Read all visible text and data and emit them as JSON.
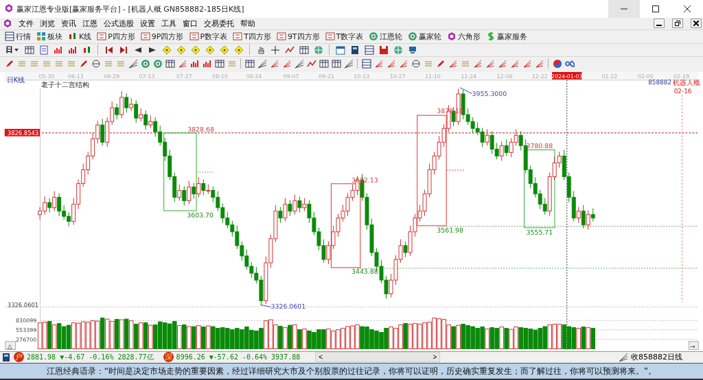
{
  "window": {
    "title": "赢家江恩专业版[赢家服务平台] - [机器人概  GN858882-185日K线]"
  },
  "menu": [
    "文件",
    "浏览",
    "资讯",
    "江恩",
    "公式选股",
    "设置",
    "工具",
    "窗口",
    "交易委托",
    "帮助"
  ],
  "toolbar": [
    "行情",
    "板块",
    "K线",
    "P四方形",
    "9P四方形",
    "P数字表",
    "T四方形",
    "9T四方形",
    "T数字表",
    "江恩轮",
    "赢家轮",
    "六角形",
    "赢家服务"
  ],
  "period_selector": {
    "label": "日"
  },
  "chart": {
    "period_label": "日K线",
    "title": "老子十二宫结构",
    "dates": [
      {
        "label": "05-30",
        "selected": false
      },
      {
        "label": "06-13",
        "selected": false
      },
      {
        "label": "06-29",
        "selected": false
      },
      {
        "label": "07-13",
        "selected": false
      },
      {
        "label": "07-27",
        "selected": false
      },
      {
        "label": "08-10",
        "selected": false
      },
      {
        "label": "08-24",
        "selected": false
      },
      {
        "label": "09-07",
        "selected": false
      },
      {
        "label": "09-21",
        "selected": false
      },
      {
        "label": "10-13",
        "selected": false
      },
      {
        "label": "10-27",
        "selected": false
      },
      {
        "label": "11-10",
        "selected": false
      },
      {
        "label": "11-24",
        "selected": false
      },
      {
        "label": "12-08",
        "selected": false
      },
      {
        "label": "12-22",
        "selected": false
      },
      {
        "label": "2024-01-03",
        "selected": true
      },
      {
        "label": "01-22",
        "selected": false
      },
      {
        "label": "02-05",
        "selected": false
      },
      {
        "label": "02-19",
        "selected": false
      }
    ],
    "annotations": [
      "3955.3000",
      "3878.18",
      "3828.68",
      "3780.88",
      "3682.13",
      "3603.70",
      "3561.98",
      "3555.71",
      "3443.88",
      "3326.0601"
    ],
    "code": "858882",
    "name": "机器人概",
    "marker_date": "02-16",
    "collapse_button": "△",
    "scroll_button": "→",
    "chart_data": {
      "type": "candlestick",
      "ylim": [
        3326.0601,
        3955.3
      ],
      "yticks": [
        {
          "value": 3826.8543,
          "label": "3826.8543"
        },
        {
          "value": 3326.0601,
          "label": "3326.0601"
        }
      ],
      "categories": [
        null,
        null,
        null,
        null,
        null,
        null,
        null,
        null,
        null,
        null,
        null,
        null,
        null,
        null,
        null,
        null,
        null,
        null,
        null,
        null,
        null,
        null,
        null,
        null,
        null,
        null,
        null,
        null,
        null,
        null,
        null,
        null,
        null,
        null,
        null,
        null,
        null,
        null,
        null,
        null,
        null,
        null,
        null,
        null,
        null,
        null,
        null,
        null,
        null,
        null,
        null,
        null,
        null,
        null,
        null,
        null,
        null,
        null,
        null,
        null,
        null,
        null,
        null,
        null,
        null,
        null,
        null,
        null,
        null,
        null,
        null,
        null,
        null,
        null,
        null,
        null,
        null,
        null,
        null,
        null,
        null,
        null,
        null,
        null,
        null,
        null,
        null,
        null,
        null,
        null,
        null,
        null,
        null,
        null,
        null,
        null,
        null,
        null,
        null,
        null,
        null,
        null,
        null,
        null,
        null,
        null,
        null,
        null,
        null,
        null,
        null,
        null,
        null,
        null,
        null,
        null
      ],
      "ohlc": [
        [
          3590,
          3612,
          3576,
          3600
        ],
        [
          3600,
          3643,
          3590,
          3625
        ],
        [
          3625,
          3637,
          3596,
          3610
        ],
        [
          3610,
          3658,
          3600,
          3640
        ],
        [
          3640,
          3652,
          3586,
          3600
        ],
        [
          3600,
          3618,
          3575,
          3585
        ],
        [
          3585,
          3597,
          3556,
          3570
        ],
        [
          3570,
          3638,
          3560,
          3620
        ],
        [
          3620,
          3692,
          3606,
          3680
        ],
        [
          3680,
          3738,
          3670,
          3720
        ],
        [
          3720,
          3772,
          3706,
          3760
        ],
        [
          3760,
          3828,
          3750,
          3810
        ],
        [
          3810,
          3862,
          3796,
          3850
        ],
        [
          3850,
          3868,
          3790,
          3800
        ],
        [
          3800,
          3872,
          3786,
          3860
        ],
        [
          3860,
          3918,
          3850,
          3900
        ],
        [
          3900,
          3912,
          3866,
          3880
        ],
        [
          3880,
          3948,
          3870,
          3930
        ],
        [
          3930,
          3942,
          3886,
          3900
        ],
        [
          3900,
          3928,
          3890,
          3910
        ],
        [
          3910,
          3922,
          3856,
          3870
        ],
        [
          3870,
          3898,
          3860,
          3880
        ],
        [
          3880,
          3892,
          3836,
          3850
        ],
        [
          3850,
          3878,
          3840,
          3860
        ],
        [
          3860,
          3872,
          3816,
          3830
        ],
        [
          3830,
          3848,
          3790,
          3800
        ],
        [
          3800,
          3812,
          3746,
          3760
        ],
        [
          3760,
          3778,
          3690,
          3700
        ],
        [
          3700,
          3712,
          3626,
          3640
        ],
        [
          3640,
          3678,
          3630,
          3660
        ],
        [
          3660,
          3672,
          3616,
          3630
        ],
        [
          3630,
          3688,
          3620,
          3670
        ],
        [
          3670,
          3682,
          3636,
          3650
        ],
        [
          3650,
          3698,
          3640,
          3680
        ],
        [
          3680,
          3692,
          3646,
          3660
        ],
        [
          3660,
          3678,
          3650,
          3660
        ],
        [
          3660,
          3672,
          3626,
          3640
        ],
        [
          3640,
          3658,
          3600,
          3610
        ],
        [
          3610,
          3622,
          3566,
          3580
        ],
        [
          3580,
          3598,
          3550,
          3560
        ],
        [
          3560,
          3572,
          3526,
          3540
        ],
        [
          3540,
          3558,
          3490,
          3500
        ],
        [
          3500,
          3512,
          3456,
          3470
        ],
        [
          3470,
          3488,
          3430,
          3440
        ],
        [
          3440,
          3452,
          3406,
          3420
        ],
        [
          3420,
          3438,
          3390,
          3400
        ],
        [
          3400,
          3412,
          3326,
          3340
        ],
        [
          3340,
          3468,
          3330,
          3450
        ],
        [
          3450,
          3532,
          3436,
          3520
        ],
        [
          3520,
          3618,
          3510,
          3600
        ],
        [
          3600,
          3612,
          3566,
          3580
        ],
        [
          3580,
          3638,
          3570,
          3620
        ],
        [
          3620,
          3632,
          3586,
          3600
        ],
        [
          3600,
          3648,
          3590,
          3630
        ],
        [
          3630,
          3642,
          3596,
          3610
        ],
        [
          3610,
          3638,
          3600,
          3620
        ],
        [
          3620,
          3632,
          3566,
          3580
        ],
        [
          3580,
          3598,
          3530,
          3540
        ],
        [
          3540,
          3552,
          3486,
          3500
        ],
        [
          3500,
          3518,
          3450,
          3460
        ],
        [
          3460,
          3512,
          3446,
          3500
        ],
        [
          3500,
          3558,
          3490,
          3540
        ],
        [
          3540,
          3592,
          3526,
          3580
        ],
        [
          3580,
          3618,
          3570,
          3600
        ],
        [
          3600,
          3652,
          3586,
          3640
        ],
        [
          3640,
          3678,
          3630,
          3660
        ],
        [
          3660,
          3702,
          3646,
          3690
        ],
        [
          3690,
          3708,
          3630,
          3640
        ],
        [
          3640,
          3652,
          3546,
          3560
        ],
        [
          3560,
          3578,
          3470,
          3480
        ],
        [
          3480,
          3492,
          3426,
          3440
        ],
        [
          3440,
          3458,
          3390,
          3400
        ],
        [
          3400,
          3412,
          3346,
          3360
        ],
        [
          3360,
          3418,
          3350,
          3400
        ],
        [
          3400,
          3472,
          3386,
          3460
        ],
        [
          3460,
          3518,
          3450,
          3500
        ],
        [
          3500,
          3512,
          3466,
          3480
        ],
        [
          3480,
          3558,
          3470,
          3540
        ],
        [
          3540,
          3592,
          3526,
          3580
        ],
        [
          3580,
          3618,
          3570,
          3600
        ],
        [
          3600,
          3662,
          3586,
          3650
        ],
        [
          3650,
          3738,
          3640,
          3720
        ],
        [
          3720,
          3772,
          3706,
          3760
        ],
        [
          3760,
          3818,
          3750,
          3800
        ],
        [
          3800,
          3852,
          3786,
          3840
        ],
        [
          3840,
          3908,
          3830,
          3890
        ],
        [
          3890,
          3902,
          3846,
          3860
        ],
        [
          3860,
          3955,
          3850,
          3940
        ],
        [
          3940,
          3952,
          3866,
          3880
        ],
        [
          3880,
          3898,
          3850,
          3860
        ],
        [
          3860,
          3872,
          3826,
          3840
        ],
        [
          3840,
          3858,
          3820,
          3830
        ],
        [
          3830,
          3842,
          3786,
          3800
        ],
        [
          3800,
          3838,
          3790,
          3820
        ],
        [
          3820,
          3832,
          3766,
          3780
        ],
        [
          3780,
          3798,
          3750,
          3760
        ],
        [
          3760,
          3802,
          3746,
          3790
        ],
        [
          3790,
          3808,
          3760,
          3770
        ],
        [
          3770,
          3812,
          3756,
          3800
        ],
        [
          3800,
          3838,
          3790,
          3820
        ],
        [
          3820,
          3832,
          3776,
          3790
        ],
        [
          3790,
          3808,
          3710,
          3720
        ],
        [
          3720,
          3732,
          3666,
          3680
        ],
        [
          3680,
          3698,
          3640,
          3650
        ],
        [
          3650,
          3662,
          3606,
          3620
        ],
        [
          3620,
          3638,
          3590,
          3600
        ],
        [
          3600,
          3712,
          3586,
          3700
        ],
        [
          3700,
          3758,
          3690,
          3740
        ],
        [
          3740,
          3772,
          3726,
          3760
        ],
        [
          3760,
          3778,
          3690,
          3700
        ],
        [
          3700,
          3712,
          3626,
          3640
        ],
        [
          3640,
          3658,
          3570,
          3580
        ],
        [
          3580,
          3612,
          3566,
          3600
        ],
        [
          3600,
          3618,
          3550,
          3560
        ],
        [
          3560,
          3602,
          3546,
          3590
        ],
        [
          3590,
          3608,
          3570,
          3580
        ]
      ]
    },
    "volume": {
      "chart_data": {
        "type": "bar",
        "ylim": [
          0,
          1225400
        ],
        "yticks": [
          {
            "value": 276700,
            "label": "276700"
          },
          {
            "value": 553399,
            "label": "553399"
          },
          {
            "value": 830099,
            "label": "830099"
          }
        ],
        "categories": [
          null,
          null,
          null,
          null,
          null,
          null,
          null,
          null,
          null,
          null,
          null,
          null,
          null,
          null,
          null,
          null,
          null,
          null,
          null,
          null,
          null,
          null,
          null,
          null,
          null,
          null,
          null,
          null,
          null,
          null,
          null,
          null,
          null,
          null,
          null,
          null,
          null,
          null,
          null,
          null,
          null,
          null,
          null,
          null,
          null,
          null,
          null,
          null,
          null,
          null,
          null,
          null,
          null,
          null,
          null,
          null,
          null,
          null,
          null,
          null,
          null,
          null,
          null,
          null,
          null,
          null,
          null,
          null,
          null,
          null,
          null,
          null,
          null,
          null,
          null,
          null,
          null,
          null,
          null,
          null,
          null,
          null,
          null,
          null,
          null,
          null,
          null,
          null,
          null,
          null,
          null,
          null,
          null,
          null,
          null,
          null,
          null,
          null,
          null,
          null,
          null,
          null,
          null,
          null,
          null,
          null,
          null,
          null,
          null,
          null,
          null,
          null,
          null,
          null,
          null,
          null
        ],
        "values": [
          760000,
          780000,
          800000,
          700000,
          740000,
          650000,
          690000,
          760000,
          750000,
          790000,
          780000,
          820000,
          810000,
          900000,
          870000,
          800000,
          860000,
          850000,
          870000,
          820000,
          720000,
          760000,
          760000,
          690000,
          700000,
          790000,
          760000,
          730000,
          800000,
          680000,
          700000,
          650000,
          650000,
          680000,
          640000,
          670000,
          650000,
          600000,
          620000,
          600000,
          560000,
          600000,
          560000,
          640000,
          540000,
          520000,
          600000,
          820000,
          850000,
          700000,
          660000,
          620000,
          690000,
          700000,
          560000,
          580000,
          520000,
          480000,
          560000,
          560000,
          580000,
          520000,
          560000,
          600000,
          650000,
          670000,
          700000,
          650000,
          640000,
          560000,
          520000,
          480000,
          600000,
          640000,
          600000,
          700000,
          740000,
          720000,
          740000,
          720000,
          760000,
          780000,
          900000,
          880000,
          860000,
          700000,
          650000,
          690000,
          720000,
          680000,
          650000,
          600000,
          640000,
          580000,
          620000,
          600000,
          640000,
          600000,
          570000,
          640000,
          620000,
          600000,
          580000,
          550000,
          600000,
          650000,
          700000,
          720000,
          720000,
          700000,
          650000,
          620000,
          600000,
          640000,
          620000,
          600000
        ]
      }
    }
  },
  "status_bar": {
    "indices": [
      {
        "badge": "户",
        "quote": "2881.98 ▼-4.67 -0.16% 2828.77亿"
      },
      {
        "badge": "深",
        "quote": "8996.26 ▼-57.62 -0.64% 3937.88"
      }
    ],
    "scroll_left": "<",
    "scroll_right": ">",
    "right_text": "收858882日线"
  },
  "quote": "江恩经典语录：“时间是决定市场走势的重要因素，经过详细研究大市及个别股票的过往记录，你将可以证明，历史确实重复发生；而了解过往，你将可以预测将来。”。"
}
